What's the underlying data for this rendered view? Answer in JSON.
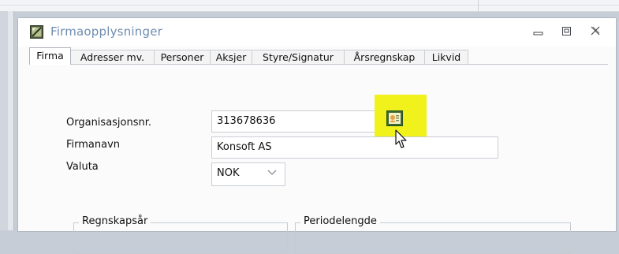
{
  "window": {
    "title": "Firmaopplysninger",
    "buttons": {
      "minimize": "minimize-icon",
      "maximize": "maximize-icon",
      "close": "close-icon"
    }
  },
  "tabs": [
    {
      "label": "Firma",
      "active": true
    },
    {
      "label": "Adresser mv.",
      "active": false
    },
    {
      "label": "Personer",
      "active": false
    },
    {
      "label": "Aksjer",
      "active": false
    },
    {
      "label": "Styre/Signatur",
      "active": false
    },
    {
      "label": "Årsregnskap",
      "active": false
    },
    {
      "label": "Likvid",
      "active": false
    }
  ],
  "form": {
    "org_label": "Organisasjonsnr.",
    "org_value": "313678636",
    "name_label": "Firmanavn",
    "name_value": "Konsoft AS",
    "currency_label": "Valuta",
    "currency_value": "NOK",
    "lookup_icon": "company-lookup-icon"
  },
  "groups": {
    "fiscal_year": "Regnskapsår",
    "period_length": "Periodelengde"
  },
  "colors": {
    "title_text": "#6f8daf",
    "highlight": "#f1f21c",
    "window_bg": "#fbfbfb"
  }
}
